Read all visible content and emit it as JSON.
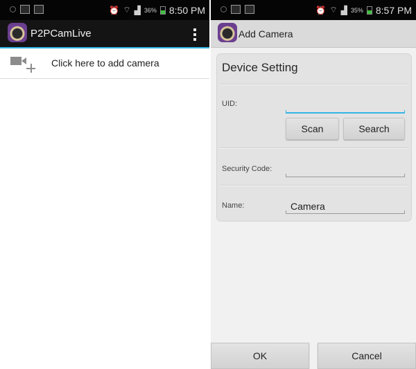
{
  "left": {
    "status_time": "8:50 PM",
    "battery": "36%",
    "app_title": "P2PCamLive",
    "add_camera_label": "Click here to add camera"
  },
  "right": {
    "status_time": "8:57 PM",
    "battery": "35%",
    "app_title": "Add Camera",
    "card_title": "Device Setting",
    "uid_label": "UID:",
    "uid_value": "",
    "scan_label": "Scan",
    "search_label": "Search",
    "security_label": "Security Code:",
    "security_value": "",
    "name_label": "Name:",
    "name_value": "Camera",
    "ok_label": "OK",
    "cancel_label": "Cancel"
  },
  "colors": {
    "accent": "#33b5e5",
    "statusbar": "#050505"
  },
  "icons": [
    "app-logo-icon",
    "overflow-menu-icon",
    "add-camera-icon",
    "alarm-icon",
    "wifi-icon",
    "signal-icon",
    "battery-icon"
  ]
}
